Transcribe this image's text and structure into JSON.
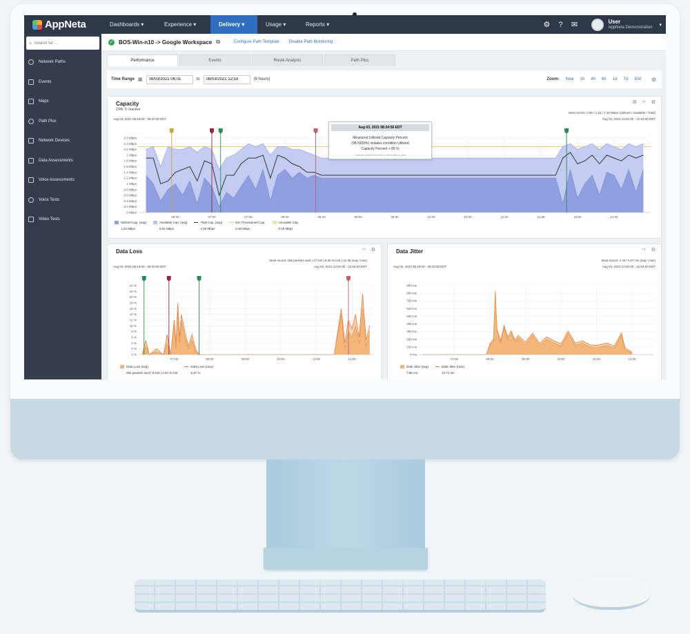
{
  "app": {
    "logo": "AppNeta",
    "nav": [
      "Dashboards ▾",
      "Experience ▾",
      "Delivery ▾",
      "Usage ▾",
      "Reports ▾"
    ],
    "nav_active": "Delivery ▾",
    "user_name": "User",
    "user_org": "AppNeta Demonstration"
  },
  "sidebar": {
    "search_placeholder": "Search for ...",
    "items": [
      "Network Paths",
      "Events",
      "Maps",
      "Path Plus",
      "Network Devices",
      "Data Assessments",
      "Voice Assessments",
      "Voice Tests",
      "Video Tests"
    ]
  },
  "path": {
    "title": "BOS-Win-n10 -> Google Workspace",
    "link1": "Configure Path Template",
    "link2": "Disable Path Monitoring"
  },
  "tabs": [
    "Performance",
    "Events",
    "Route Analysis",
    "Path Plus"
  ],
  "timebar": {
    "label": "Time Range",
    "start": "08/03/2021 06:01",
    "to": "to",
    "end": "08/03/2021 12:53",
    "duration": "(6 hours)",
    "zoom_label": "Zoom:",
    "zoom_options": [
      "Now",
      "1h",
      "4h",
      "6h",
      "1d",
      "7d",
      "30d"
    ]
  },
  "capacity": {
    "title": "Capacity",
    "sub": "CPA: 3: Inactive",
    "range": "Aug 03, 2021 06:18:00 - 08:20:00 EDT",
    "most_recent": "Most recent: 0.95 / 1.15 / 2.18 Mbps (Utilized / Available / Total)",
    "range_right": "Aug 03, 2021 12:52:00 - 12:54:00 EDT",
    "legend": [
      {
        "label": "Utilized Cap. (avg)",
        "value": "1.23 Mbps",
        "color": "#8f9fe0"
      },
      {
        "label": "Available Cap. (avg)",
        "value": "5.84 Mbps",
        "color": "#b8c2f0"
      },
      {
        "label": "Total Cap. (avg)",
        "value": "2.09 Mbps",
        "color": "#333333"
      },
      {
        "label": "Est. Provisioned Cap.",
        "value": "2.38 Mbps",
        "color": "#e8c85a"
      },
      {
        "label": "Unusable Cap.",
        "value": "0.29 Mbps",
        "color": "#f3e39a"
      }
    ],
    "tooltip": {
      "header": "Aug 03, 2021 08:24:56 EDT",
      "body1": "Measured Utilized Capacity Percent",
      "body2": "(98.5500%) violates condition Utilized",
      "body3": "Capacity Percent > 85 %",
      "footer": "* click the hovered element or text tooltip in place"
    }
  },
  "loss": {
    "title": "Data Loss",
    "most_recent": "Most recent: 268 packets sent | 27 lost | 8.36 % lost | 12.35 (avg / max)",
    "range": "Aug 03, 2021 06:18:00 - 08:20:00 EDT",
    "range_right": "Aug 03, 2021 12:52:00 - 12:54:00 EDT",
    "legend": [
      {
        "label": "Data Loss (avg)",
        "value": "282 packets sent | 8 lost | 2.94 % lost",
        "color": "#f2b57a"
      },
      {
        "label": "Data Loss (max)",
        "value": "6.37 %",
        "color": "#e97a3a"
      }
    ]
  },
  "jitter": {
    "title": "Data Jitter",
    "most_recent": "Most recent: 2.44 / 5.07 ms (avg / max)",
    "range": "Aug 03, 2021 08:18:00 - 08:20:00 EDT",
    "range_right": "Aug 03, 2021 12:52:00 - 12:54:00 EDT",
    "legend": [
      {
        "label": "Data Jitter (avg)",
        "value": "7.86 ms",
        "color": "#f2b57a"
      },
      {
        "label": "Data Jitter (max)",
        "value": "12.71 ms",
        "color": "#e97a3a"
      }
    ]
  },
  "chart_data": [
    {
      "type": "area",
      "title": "Capacity",
      "ylabel": "",
      "ylim": [
        0,
        2.6
      ],
      "x_tick_labels": [
        "06:30",
        "07:00",
        "07:30",
        "08:00",
        "08:30",
        "09:00",
        "09:30",
        "10:00",
        "10:30",
        "11:00",
        "11:30",
        "12:00",
        "12:30"
      ],
      "y_tick_labels": [
        "0 Mbps",
        "0.2 Mbps",
        "0.4 Mbps",
        "0.6 Mbps",
        "0.8 Mbps",
        "1 Mbps",
        "1.2 Mbps",
        "1.4 Mbps",
        "1.6 Mbps",
        "1.8 Mbps",
        "2 Mbps",
        "2.2 Mbps",
        "2.4 Mbps",
        "2.6 Mbps"
      ],
      "x_hours": [
        6.1,
        6.2,
        6.3,
        6.4,
        6.5,
        6.6,
        6.7,
        6.8,
        6.9,
        7.0,
        7.1,
        7.2,
        7.3,
        7.4,
        7.5,
        7.6,
        7.7,
        7.8,
        7.9,
        8.0,
        8.1,
        8.2,
        8.3,
        8.4,
        8.5,
        9.0,
        10.0,
        11.0,
        11.7,
        11.8,
        11.9,
        12.0,
        12.1,
        12.2,
        12.3,
        12.4,
        12.5,
        12.6,
        12.7,
        12.8,
        12.9
      ],
      "series": [
        {
          "name": "Available Cap. (avg)",
          "values": [
            2.2,
            2.3,
            1.6,
            2.3,
            2.2,
            2.2,
            2.3,
            2.1,
            2.3,
            2.2,
            1.5,
            1.9,
            2.0,
            2.2,
            2.4,
            2.3,
            2.4,
            2.0,
            2.3,
            2.3,
            2.2,
            2.2,
            2.1,
            2.0,
            1.9,
            1.9,
            1.9,
            1.9,
            1.9,
            2.3,
            2.4,
            2.2,
            2.3,
            2.4,
            2.2,
            2.4,
            2.3,
            2.2,
            2.4,
            2.3,
            2.4
          ]
        },
        {
          "name": "Total Cap. (avg)",
          "values": [
            1.9,
            1.9,
            1.0,
            1.1,
            1.4,
            1.5,
            1.6,
            1.1,
            1.8,
            1.7,
            0.6,
            1.3,
            1.3,
            1.7,
            1.9,
            1.9,
            2.0,
            1.2,
            2.0,
            1.9,
            1.7,
            1.6,
            1.4,
            1.4,
            1.3,
            1.3,
            1.3,
            1.3,
            1.3,
            1.9,
            2.1,
            1.7,
            1.8,
            2.0,
            1.7,
            2.0,
            1.9,
            1.8,
            2.0,
            1.9,
            2.0
          ]
        },
        {
          "name": "Utilized Cap. (avg)",
          "values": [
            1.3,
            1.0,
            0.4,
            0.8,
            1.0,
            0.6,
            1.1,
            0.3,
            1.2,
            0.9,
            0.2,
            0.7,
            0.5,
            0.9,
            1.3,
            0.8,
            1.5,
            0.4,
            1.3,
            1.5,
            1.2,
            1.4,
            1.2,
            1.3,
            1.2,
            1.2,
            1.2,
            1.2,
            1.2,
            0.3,
            1.5,
            0.5,
            1.0,
            1.3,
            0.6,
            1.4,
            1.3,
            0.8,
            1.5,
            0.7,
            1.5
          ]
        },
        {
          "name": "Est. Provisioned Cap.",
          "values": [
            2.3
          ]
        }
      ]
    },
    {
      "type": "area",
      "title": "Data Loss",
      "ylim": [
        0,
        24
      ],
      "x_tick_labels": [
        "07:00",
        "08:00",
        "09:00",
        "10:00",
        "11:00",
        "12:00"
      ],
      "y_tick_labels": [
        "0 %",
        "2 %",
        "4 %",
        "6 %",
        "8 %",
        "10 %",
        "12 %",
        "14 %",
        "16 %",
        "18 %",
        "20 %",
        "22 %",
        "24 %"
      ],
      "x_hours": [
        6.1,
        6.2,
        6.3,
        6.5,
        6.7,
        6.8,
        6.9,
        7.0,
        7.05,
        7.1,
        7.15,
        7.2,
        7.3,
        7.4,
        7.5,
        7.6,
        7.7,
        8.0,
        9.0,
        10.0,
        11.0,
        11.5,
        11.7,
        11.8,
        11.9,
        12.0,
        12.1,
        12.2,
        12.3,
        12.4,
        12.5
      ],
      "series": [
        {
          "name": "Data Loss (avg)",
          "values": [
            0,
            3,
            0,
            1,
            0,
            4,
            0,
            10,
            2,
            15,
            4,
            12,
            6,
            2,
            5,
            1,
            0,
            0,
            0,
            0,
            0,
            0,
            14,
            2,
            8,
            6,
            10,
            4,
            16,
            3,
            8
          ]
        },
        {
          "name": "Data Loss (max)",
          "values": [
            0,
            5,
            0,
            2,
            0,
            7,
            0,
            12,
            4,
            18,
            6,
            14,
            8,
            3,
            7,
            2,
            0,
            0,
            0,
            0,
            0,
            0,
            16,
            4,
            12,
            9,
            14,
            6,
            21,
            5,
            10
          ]
        }
      ]
    },
    {
      "type": "area",
      "title": "Data Jitter",
      "ylim": [
        0,
        900
      ],
      "x_tick_labels": [
        "07:00",
        "08:00",
        "09:00",
        "10:00",
        "11:00",
        "12:00"
      ],
      "y_tick_labels": [
        "0 ms",
        "100 ms",
        "200 ms",
        "300 ms",
        "400 ms",
        "500 ms",
        "600 ms",
        "700 ms",
        "800 ms",
        "900 ms"
      ],
      "x_hours": [
        6.1,
        7.0,
        7.9,
        8.0,
        8.1,
        8.15,
        8.2,
        8.3,
        8.4,
        8.5,
        8.6,
        8.7,
        8.8,
        9.0,
        9.2,
        9.4,
        9.6,
        9.8,
        10.0,
        10.2,
        10.4,
        10.6,
        10.8,
        11.0,
        11.3,
        11.5,
        11.7,
        11.8,
        12.0
      ],
      "series": [
        {
          "name": "Data Jitter (avg)",
          "values": [
            0,
            0,
            0,
            120,
            180,
            800,
            300,
            150,
            350,
            200,
            280,
            160,
            220,
            130,
            250,
            120,
            200,
            150,
            110,
            280,
            120,
            150,
            100,
            90,
            120,
            80,
            250,
            60,
            20
          ]
        },
        {
          "name": "Data Jitter (max)",
          "values": [
            0,
            0,
            0,
            140,
            200,
            830,
            330,
            180,
            380,
            230,
            310,
            190,
            250,
            160,
            280,
            150,
            230,
            180,
            140,
            310,
            150,
            180,
            130,
            120,
            150,
            110,
            280,
            90,
            30
          ]
        }
      ]
    }
  ]
}
